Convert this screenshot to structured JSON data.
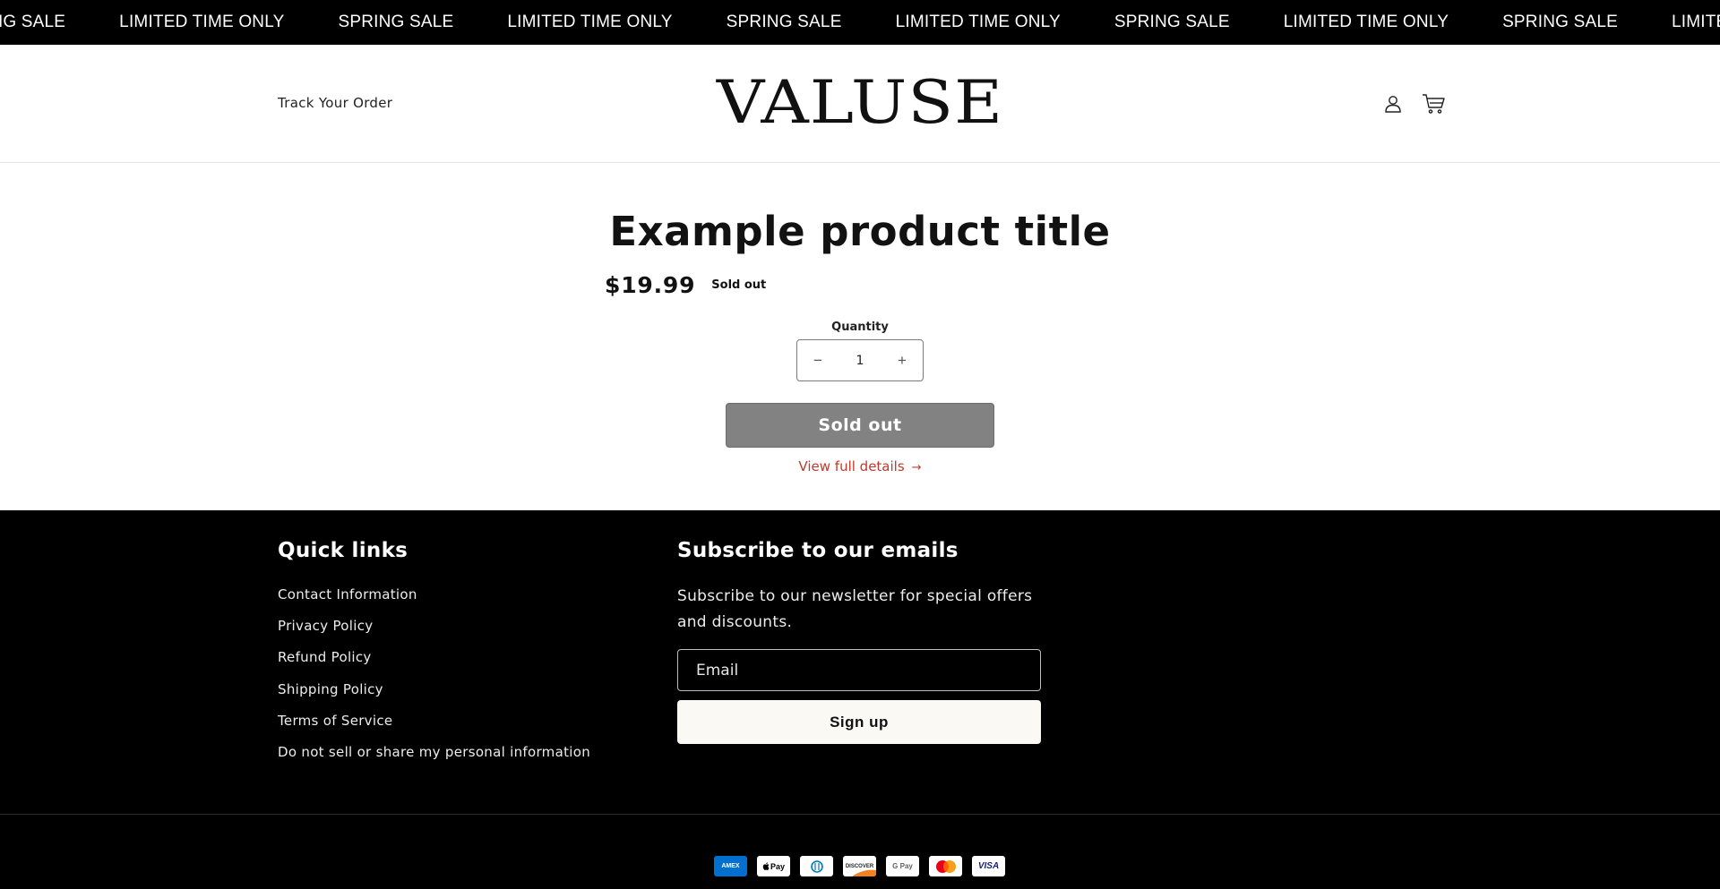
{
  "announcement": {
    "items": [
      "RING SALE",
      "LIMITED TIME ONLY",
      "SPRING SALE",
      "LIMITED TIME ONLY",
      "SPRING SALE",
      "LIMITED TIME ONLY",
      "SPRING SALE",
      "LIMITED TIME ONLY",
      "SPRING SALE",
      "LIMITED TIME ONLY"
    ]
  },
  "header": {
    "track_order": "Track Your Order",
    "logo": "VALUSE",
    "icons": [
      "account-icon",
      "cart-icon"
    ]
  },
  "product": {
    "title": "Example product title",
    "price": "$19.99",
    "badge": "Sold out",
    "quantity_label": "Quantity",
    "quantity_value": "1",
    "decrease": "−",
    "increase": "+",
    "button_label": "Sold out",
    "details_link": "View full details",
    "details_arrow": "→"
  },
  "footer": {
    "quick_links_heading": "Quick links",
    "quick_links": [
      "Contact Information",
      "Privacy Policy",
      "Refund Policy",
      "Shipping Policy",
      "Terms of Service",
      "Do not sell or share my personal information"
    ],
    "subscribe_heading": "Subscribe to our emails",
    "subscribe_text": "Subscribe to our newsletter for special offers and discounts.",
    "email_placeholder": "Email",
    "signup_label": "Sign up",
    "payment_methods": [
      {
        "name": "American Express",
        "label": "AMEX",
        "bg": "#006fcf",
        "fg": "#ffffff"
      },
      {
        "name": "Apple Pay",
        "label": "Pay",
        "bg": "#ffffff",
        "fg": "#000000"
      },
      {
        "name": "Diners Club",
        "label": "D",
        "bg": "#ffffff",
        "fg": "#0079be"
      },
      {
        "name": "Discover",
        "label": "DISCOVER",
        "bg": "#ffffff",
        "fg": "#231f20"
      },
      {
        "name": "Google Pay",
        "label": "G Pay",
        "bg": "#ffffff",
        "fg": "#5f6368"
      },
      {
        "name": "Mastercard",
        "label": "",
        "bg": "#ffffff",
        "fg": "#000000"
      },
      {
        "name": "Visa",
        "label": "VISA",
        "bg": "#ffffff",
        "fg": "#1a1f71"
      }
    ]
  },
  "colors": {
    "announcement_bg": "#000000",
    "footer_bg": "#000000",
    "soldout_button": "#828282",
    "link_accent": "#c0392b"
  }
}
